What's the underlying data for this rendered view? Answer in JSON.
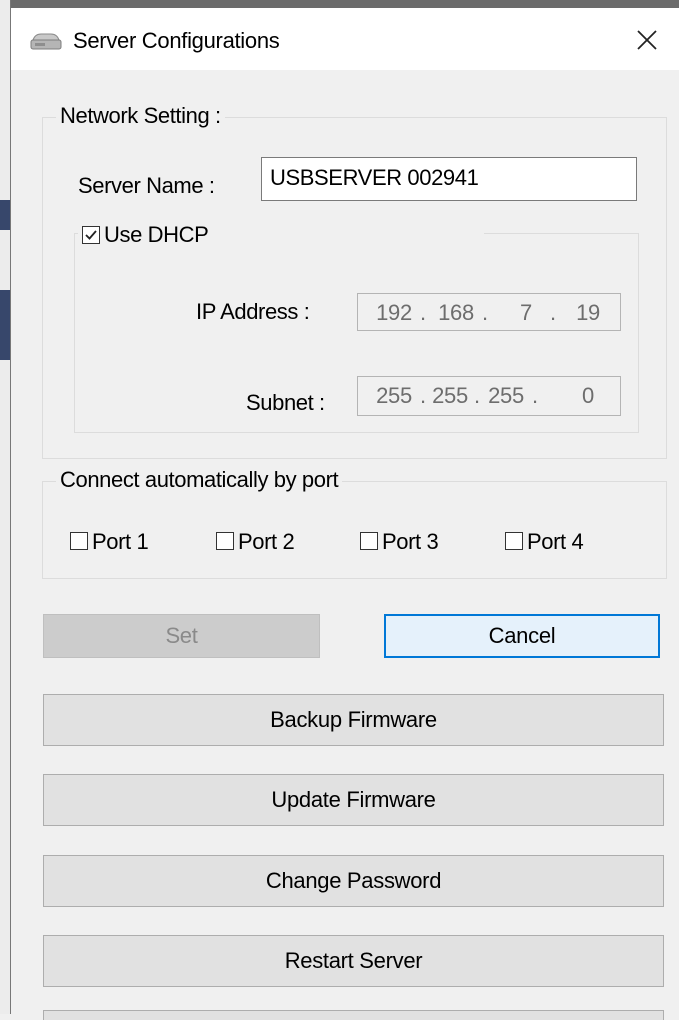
{
  "window": {
    "title": "Server Configurations",
    "close_glyph": "✕",
    "icon": "server-icon"
  },
  "network_setting": {
    "legend": "Network Setting :",
    "server_name_label": "Server Name :",
    "server_name_value": "USBSERVER 002941",
    "use_dhcp_label": "Use DHCP",
    "use_dhcp_checked": true,
    "ip_address_label": "IP Address :",
    "ip_address": {
      "o1": "192",
      "o2": "168",
      "o3": "7",
      "o4": "19"
    },
    "subnet_label": "Subnet :",
    "subnet": {
      "o1": "255",
      "o2": "255",
      "o3": "255",
      "o4": "0"
    }
  },
  "ports": {
    "legend": "Connect automatically by port",
    "items": [
      {
        "label": "Port 1",
        "checked": false
      },
      {
        "label": "Port 2",
        "checked": false
      },
      {
        "label": "Port 3",
        "checked": false
      },
      {
        "label": "Port 4",
        "checked": false
      }
    ]
  },
  "buttons": {
    "set": "Set",
    "cancel": "Cancel",
    "backup_firmware": "Backup Firmware",
    "update_firmware": "Update Firmware",
    "change_password": "Change Password",
    "restart_server": "Restart Server"
  },
  "colors": {
    "focus_accent": "#0078d7",
    "background": "#f0f0f0"
  }
}
